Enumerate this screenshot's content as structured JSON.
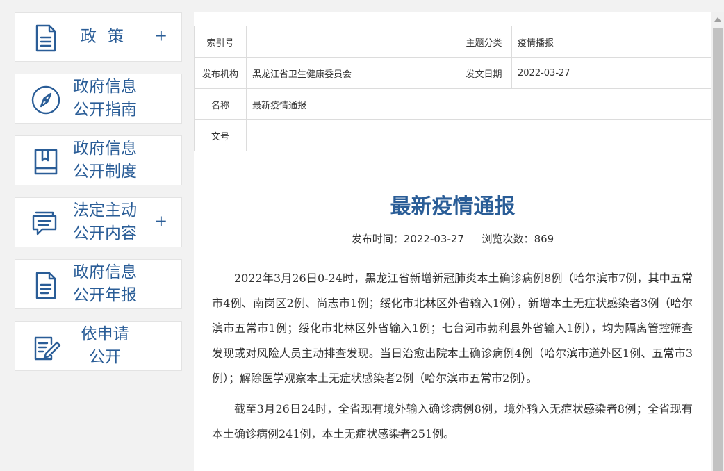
{
  "sidebar": {
    "items": [
      {
        "label": "政策",
        "lines": [],
        "plus": "+",
        "icon": "document-icon"
      },
      {
        "label": "",
        "lines": [
          "政府信息",
          "公开指南"
        ],
        "plus": "",
        "icon": "compass-icon"
      },
      {
        "label": "",
        "lines": [
          "政府信息",
          "公开制度"
        ],
        "plus": "",
        "icon": "book-icon"
      },
      {
        "label": "",
        "lines": [
          "法定主动",
          "公开内容"
        ],
        "plus": "+",
        "icon": "chat-bubbles-icon"
      },
      {
        "label": "",
        "lines": [
          "政府信息",
          "公开年报"
        ],
        "plus": "",
        "icon": "report-icon"
      },
      {
        "label": "",
        "lines": [
          "依申请",
          "公开"
        ],
        "plus": "",
        "icon": "edit-document-icon"
      }
    ]
  },
  "meta": {
    "index_label": "索引号",
    "index_value": "",
    "topic_label": "主题分类",
    "topic_value": "疫情播报",
    "publisher_label": "发布机构",
    "publisher_value": "黑龙江省卫生健康委员会",
    "date_label": "发文日期",
    "date_value": "2022-03-27",
    "name_label": "名称",
    "name_value": "最新疫情通报",
    "docno_label": "文号",
    "docno_value": ""
  },
  "article": {
    "title": "最新疫情通报",
    "publish_label": "发布时间：",
    "publish_time": "2022-03-27",
    "views_label": "浏览次数：",
    "views": "869",
    "paragraphs": [
      "2022年3月26日0-24时，黑龙江省新增新冠肺炎本土确诊病例8例（哈尔滨市7例，其中五常市4例、南岗区2例、尚志市1例；绥化市北林区外省输入1例），新增本土无症状感染者3例（哈尔滨市五常市1例；绥化市北林区外省输入1例；七台河市勃利县外省输入1例），均为隔离管控筛查发现或对风险人员主动排查发现。当日治愈出院本土确诊病例4例（哈尔滨市道外区1例、五常市3例）；解除医学观察本土无症状感染者2例（哈尔滨市五常市2例）。",
      "截至3月26日24时，全省现有境外输入确诊病例8例，境外输入无症状感染者8例；全省现有本土确诊病例241例，本土无症状感染者251例。"
    ]
  },
  "colors": {
    "accent": "#2a5d97",
    "background": "#f2f2f2",
    "panel": "#ffffff",
    "border": "#dcdcdc"
  }
}
